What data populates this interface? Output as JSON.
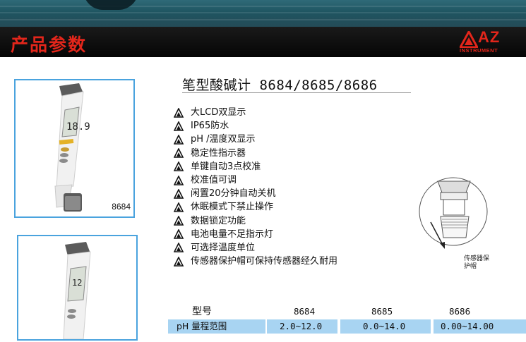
{
  "header": {
    "title": "产品参数",
    "logo_brand": "AZ",
    "logo_sub": "INSTRUMENT",
    "accent_color": "#e3261b"
  },
  "product": {
    "title": "笔型酸碱计  8684/8685/8686"
  },
  "photos": [
    {
      "model": "8684"
    },
    {
      "model": ""
    }
  ],
  "features": [
    "大LCD双显示",
    "IP65防水",
    "pH /温度双显示",
    "稳定性指示器",
    "单键自动3点校准",
    "校准值可调",
    "闲置20分钟自动关机",
    "休眠模式下禁止操作",
    "数据锁定功能",
    "电池电量不足指示灯",
    "可选择温度单位",
    "传感器保护帽可保持传感器经久耐用"
  ],
  "sensor_caption": "传感器保护帽",
  "spec_table": {
    "header": {
      "label": "型号",
      "values": [
        "8684",
        "8685",
        "8686"
      ]
    },
    "rows": [
      {
        "label": "pH 量程范围",
        "values": [
          "2.0~12.0",
          "0.0~14.0",
          "0.00~14.00"
        ]
      }
    ],
    "highlight_color": "#a8d4f2"
  }
}
